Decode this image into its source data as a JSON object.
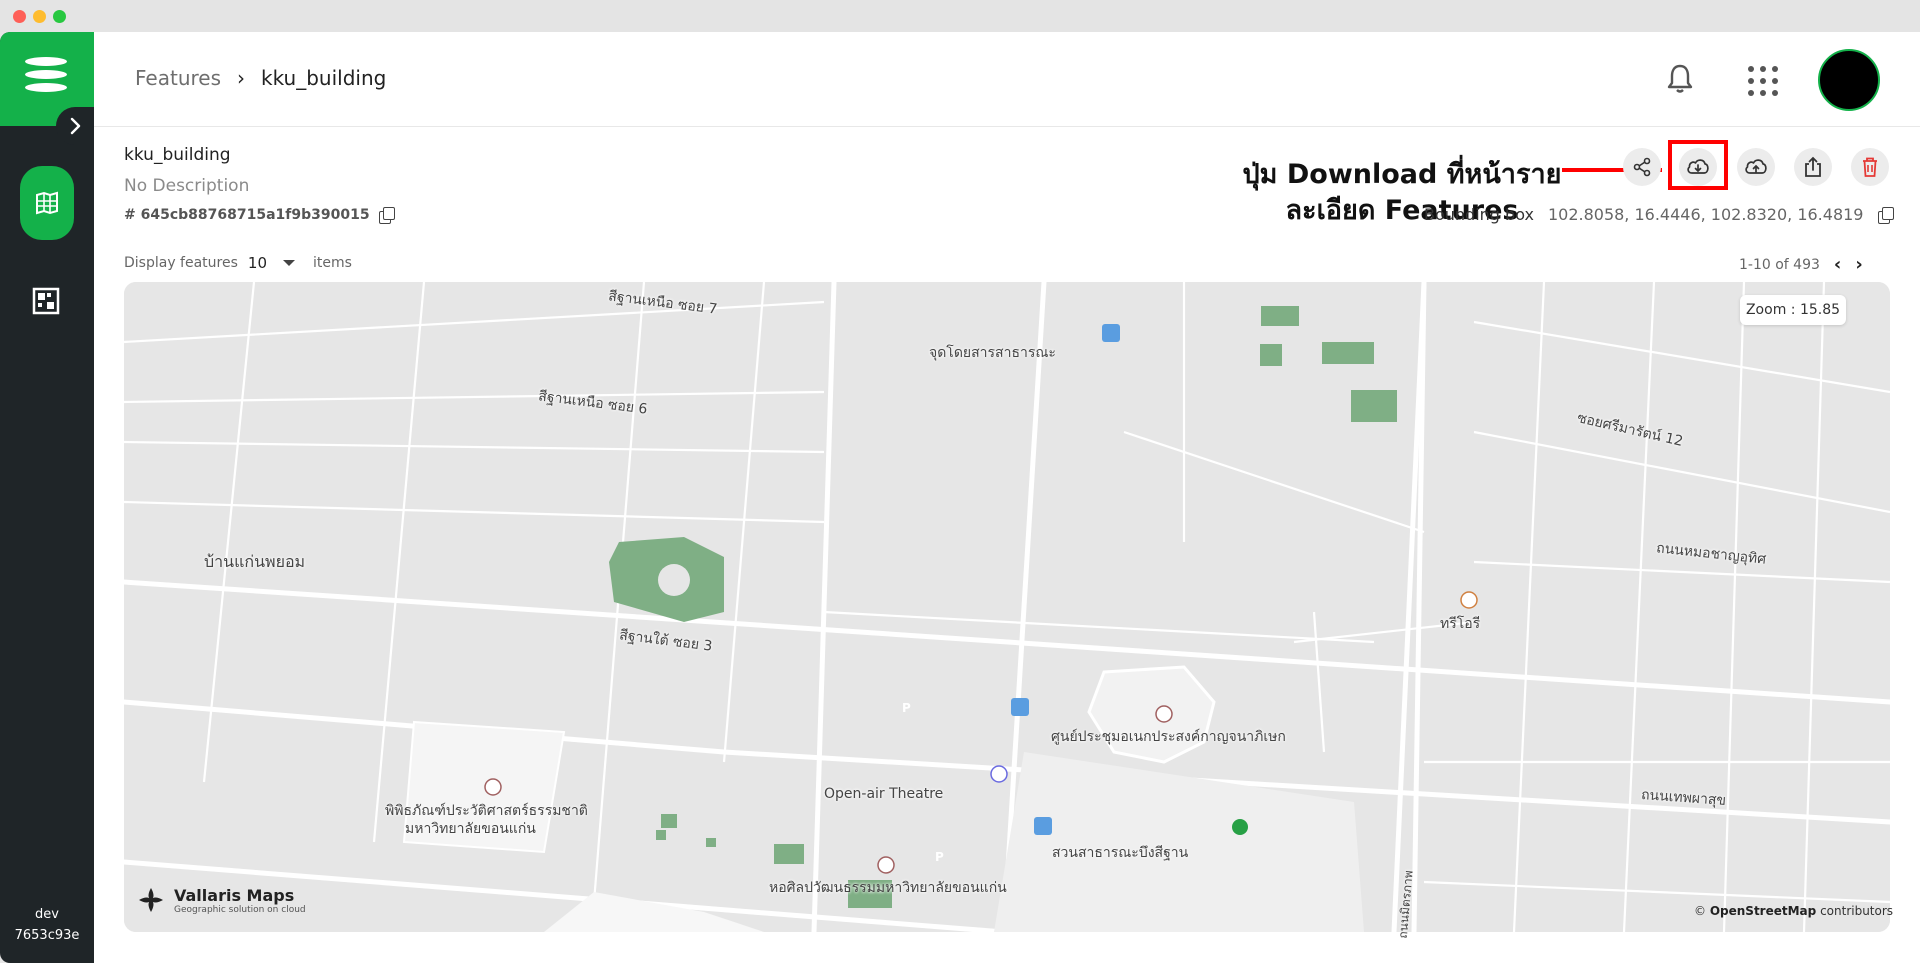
{
  "sidebar": {
    "user": "dev",
    "user_id": "7653c93e"
  },
  "breadcrumb": {
    "parent": "Features",
    "separator": "›",
    "current": "kku_building"
  },
  "layer": {
    "title": "kku_building",
    "description": "No Description",
    "id": "# 645cb88768715a1f9b390015",
    "bounding_box_label": "Bounding box",
    "bounding_box_value": "102.8058, 16.4446, 102.8320, 16.4819"
  },
  "annotation": {
    "line1": "ปุ่ม Download ที่หน้าราย",
    "line2": "ละเอียด Features"
  },
  "display": {
    "label": "Display features",
    "count": "10",
    "suffix": "items",
    "pager": "1-10 of 493"
  },
  "map": {
    "zoom": "Zoom : 15.85",
    "brand": "Vallaris Maps",
    "brand_sub": "Geographic solution on cloud",
    "attribution_prefix": "© ",
    "attribution_link": "OpenStreetMap",
    "attribution_suffix": " contributors",
    "labels": [
      "สีฐานเหนือ ซอย 7",
      "จุดโดยสารสาธารณะ",
      "สีฐานเหนือ ซอย 6",
      "ซอยศรีมารัตน์ 12",
      "ถนนหมอชาญอุทิศ",
      "บ้านแก่นพยอม",
      "สีฐานใต้ ซอย 3",
      "ทรีโอรี",
      "ศูนย์ประชุมอเนกประสงค์กาญจนาภิเษก",
      "Open-air Theatre",
      "พิพิธภัณฑ์ประวัติศาสตร์ธรรมชาติ",
      "มหาวิทยาลัยขอนแก่น",
      "ถนนเทพผาสุข",
      "สวนสาธารณะบึงสีฐาน",
      "หอศิลปวัฒนธรรมมหาวิทยาลัยขอนแก่น",
      "ถนนมิตรภาพ",
      "P",
      "P"
    ]
  },
  "colors": {
    "brand": "#14b14a",
    "sidebar": "#1f2528",
    "delete": "#e53935",
    "annotation": "#ff0000"
  }
}
